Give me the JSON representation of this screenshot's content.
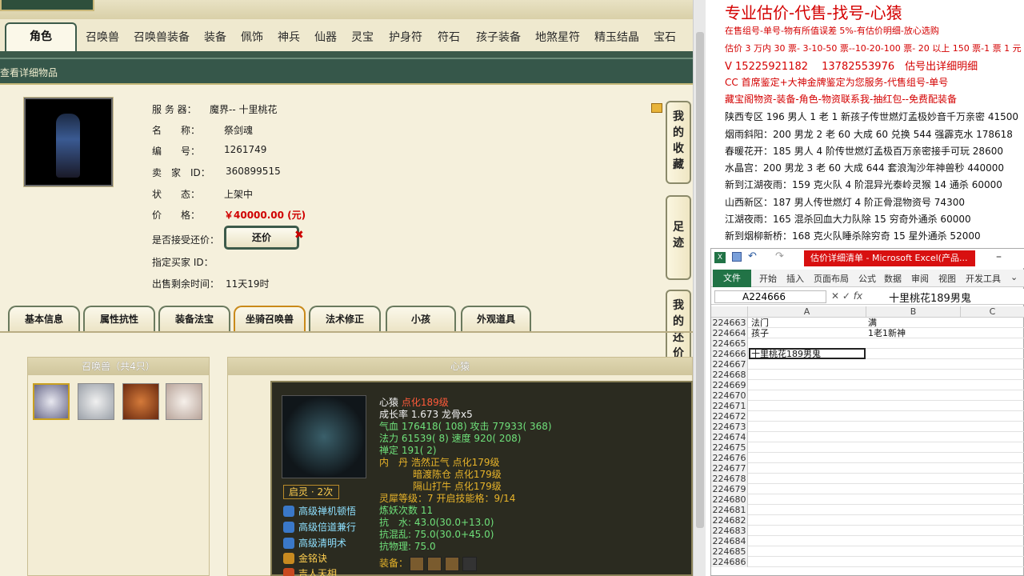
{
  "tabs": [
    "角色",
    "召唤兽",
    "召唤兽装备",
    "装备",
    "佩饰",
    "神兵",
    "仙器",
    "灵宝",
    "护身符",
    "符石",
    "孩子装备",
    "地煞星符",
    "精玉结晶",
    "宝石"
  ],
  "subbar_title": "查看详细物品",
  "char": {
    "server_label": "服 务 器：",
    "server": "魔界-- 十里桃花",
    "name_label": "名　　称：",
    "name": "祭剑魂",
    "id_label": "编　　号：",
    "id": "1261749",
    "seller_label": "卖　家　ID：",
    "seller": "360899515",
    "status_label": "状　　态：",
    "status": "上架中",
    "price_label": "价　　格：",
    "price": "￥40000.00 (元)",
    "counter_label": "是否接受还价：",
    "counter_btn": "还价",
    "counter_x": "✖",
    "buyer_label": "指定买家 ID：",
    "remain_label": "出售剩余时间：",
    "remain": "11天19时"
  },
  "side_buttons": [
    "我的收藏",
    "足迹",
    "我的还价"
  ],
  "detail_tabs": [
    "基本信息",
    "属性抗性",
    "装备法宝",
    "坐骑召唤兽",
    "法术修正",
    "小孩",
    "外观道具"
  ],
  "left_panel_title": "召唤兽（共4只）",
  "right_panel_title": "心猿",
  "tip": {
    "name": "心猿",
    "tag": "点化189级",
    "l1": "成长率 1.673 龙骨x5",
    "l2": "气血 176418( 108) 攻击 77933( 368)",
    "l3": "法力 61539( 8) 速度 920( 208)",
    "l4": "禅定 191( 2)",
    "l5": "内　丹 浩然正气 点化179级",
    "l6": "暗渡陈仓 点化179级",
    "l7": "隔山打牛 点化179级",
    "qiling": "启灵 · 2次",
    "l8": "灵犀等级：7 开启技能格：9/14",
    "l9": "炼妖次数 11",
    "l10": "抗　水: 43.0(30.0+13.0)",
    "l11": "抗混乱: 75.0(30.0+45.0)",
    "l12": "抗物理: 75.0",
    "equip": "装备：",
    "skills": [
      "高级禅机顿悟",
      "高级倍道兼行",
      "高级清明术",
      "金铭诀",
      "吉人天相"
    ]
  },
  "note": {
    "title": "专业估价-代售-找号-心猿",
    "lines_red": [
      "在售组号-单号-物有所值误差 5%-有估价明细-放心选购",
      "估价 3 万内 30 票- 3-10-50 票--10-20-100 票- 20 以上 150 票-1 票 1 元",
      "V 15225921182　 13782553976　估号出详细明细",
      "CC 首席鉴定+大神金牌鉴定为您服务-代售组号-单号",
      "藏宝阁物资-装备-角色-物资联系我-抽红包--免费配装备"
    ],
    "lines_black": [
      "陕西专区 196 男人 1 老 1 新孩子传世燃灯孟极妙音千万亲密 41500",
      "烟雨斜阳：200 男龙 2 老 60 大成 60 兑换 544 强霹克水 178618",
      "春暖花开：185 男人 4 阶传世燃灯孟极百万亲密接手可玩 28600",
      "水晶宫：200 男龙 3 老 60 大成 644 套浪淘沙年神兽秒 440000",
      "新到江湖夜雨：159 克火队 4 阶混异光泰岭灵猴 14 通杀 60000",
      "山西新区：187 男人传世燃灯 4 阶正骨混物资号 74300",
      "江湖夜雨：165 混杀回血大力队除 15 穷奇外通杀 60000",
      "新到烟柳新桥：168 克火队睡杀除穷奇 15 星外通杀 52000"
    ]
  },
  "excel": {
    "title": "估价详细清单 - Microsoft Excel(产品...",
    "file": "文件",
    "ribbon": [
      "开始",
      "插入",
      "页面布局",
      "公式",
      "数据",
      "审阅",
      "视图",
      "开发工具"
    ],
    "namebox": "A224666",
    "formula": "十里桃花189男鬼",
    "cols": [
      "A",
      "B",
      "C"
    ],
    "rows": [
      {
        "n": "224663",
        "a": "法门",
        "b": "满"
      },
      {
        "n": "224664",
        "a": "孩子",
        "b": "1老1新神"
      },
      {
        "n": "224665",
        "a": "",
        "b": ""
      },
      {
        "n": "224666",
        "a": "十里桃花189男鬼",
        "b": ""
      },
      {
        "n": "224667",
        "a": "",
        "b": ""
      },
      {
        "n": "224668",
        "a": "",
        "b": ""
      },
      {
        "n": "224669",
        "a": "",
        "b": ""
      },
      {
        "n": "224670",
        "a": "",
        "b": ""
      },
      {
        "n": "224671",
        "a": "",
        "b": ""
      },
      {
        "n": "224672",
        "a": "",
        "b": ""
      },
      {
        "n": "224673",
        "a": "",
        "b": ""
      },
      {
        "n": "224674",
        "a": "",
        "b": ""
      },
      {
        "n": "224675",
        "a": "",
        "b": ""
      },
      {
        "n": "224676",
        "a": "",
        "b": ""
      },
      {
        "n": "224677",
        "a": "",
        "b": ""
      },
      {
        "n": "224678",
        "a": "",
        "b": ""
      },
      {
        "n": "224679",
        "a": "",
        "b": ""
      },
      {
        "n": "224680",
        "a": "",
        "b": ""
      },
      {
        "n": "224681",
        "a": "",
        "b": ""
      },
      {
        "n": "224682",
        "a": "",
        "b": ""
      },
      {
        "n": "224683",
        "a": "",
        "b": ""
      },
      {
        "n": "224684",
        "a": "",
        "b": ""
      },
      {
        "n": "224685",
        "a": "",
        "b": ""
      },
      {
        "n": "224686",
        "a": "",
        "b": ""
      }
    ]
  }
}
